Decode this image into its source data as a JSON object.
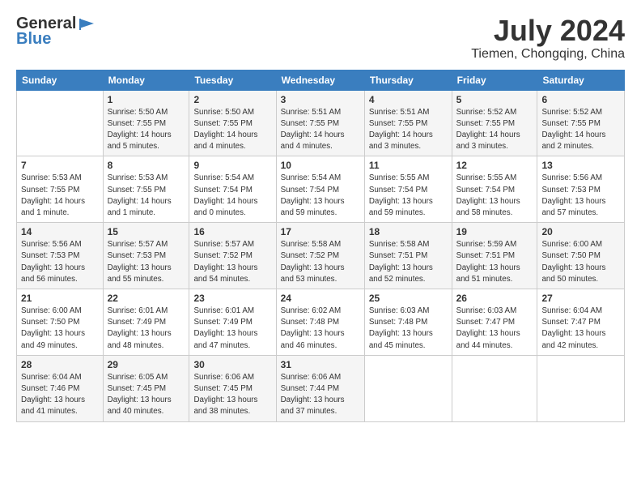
{
  "header": {
    "logo_general": "General",
    "logo_blue": "Blue",
    "month": "July 2024",
    "location": "Tiemen, Chongqing, China"
  },
  "weekdays": [
    "Sunday",
    "Monday",
    "Tuesday",
    "Wednesday",
    "Thursday",
    "Friday",
    "Saturday"
  ],
  "weeks": [
    [
      {
        "day": "",
        "info": ""
      },
      {
        "day": "1",
        "info": "Sunrise: 5:50 AM\nSunset: 7:55 PM\nDaylight: 14 hours\nand 5 minutes."
      },
      {
        "day": "2",
        "info": "Sunrise: 5:50 AM\nSunset: 7:55 PM\nDaylight: 14 hours\nand 4 minutes."
      },
      {
        "day": "3",
        "info": "Sunrise: 5:51 AM\nSunset: 7:55 PM\nDaylight: 14 hours\nand 4 minutes."
      },
      {
        "day": "4",
        "info": "Sunrise: 5:51 AM\nSunset: 7:55 PM\nDaylight: 14 hours\nand 3 minutes."
      },
      {
        "day": "5",
        "info": "Sunrise: 5:52 AM\nSunset: 7:55 PM\nDaylight: 14 hours\nand 3 minutes."
      },
      {
        "day": "6",
        "info": "Sunrise: 5:52 AM\nSunset: 7:55 PM\nDaylight: 14 hours\nand 2 minutes."
      }
    ],
    [
      {
        "day": "7",
        "info": "Sunrise: 5:53 AM\nSunset: 7:55 PM\nDaylight: 14 hours\nand 1 minute."
      },
      {
        "day": "8",
        "info": "Sunrise: 5:53 AM\nSunset: 7:55 PM\nDaylight: 14 hours\nand 1 minute."
      },
      {
        "day": "9",
        "info": "Sunrise: 5:54 AM\nSunset: 7:54 PM\nDaylight: 14 hours\nand 0 minutes."
      },
      {
        "day": "10",
        "info": "Sunrise: 5:54 AM\nSunset: 7:54 PM\nDaylight: 13 hours\nand 59 minutes."
      },
      {
        "day": "11",
        "info": "Sunrise: 5:55 AM\nSunset: 7:54 PM\nDaylight: 13 hours\nand 59 minutes."
      },
      {
        "day": "12",
        "info": "Sunrise: 5:55 AM\nSunset: 7:54 PM\nDaylight: 13 hours\nand 58 minutes."
      },
      {
        "day": "13",
        "info": "Sunrise: 5:56 AM\nSunset: 7:53 PM\nDaylight: 13 hours\nand 57 minutes."
      }
    ],
    [
      {
        "day": "14",
        "info": "Sunrise: 5:56 AM\nSunset: 7:53 PM\nDaylight: 13 hours\nand 56 minutes."
      },
      {
        "day": "15",
        "info": "Sunrise: 5:57 AM\nSunset: 7:53 PM\nDaylight: 13 hours\nand 55 minutes."
      },
      {
        "day": "16",
        "info": "Sunrise: 5:57 AM\nSunset: 7:52 PM\nDaylight: 13 hours\nand 54 minutes."
      },
      {
        "day": "17",
        "info": "Sunrise: 5:58 AM\nSunset: 7:52 PM\nDaylight: 13 hours\nand 53 minutes."
      },
      {
        "day": "18",
        "info": "Sunrise: 5:58 AM\nSunset: 7:51 PM\nDaylight: 13 hours\nand 52 minutes."
      },
      {
        "day": "19",
        "info": "Sunrise: 5:59 AM\nSunset: 7:51 PM\nDaylight: 13 hours\nand 51 minutes."
      },
      {
        "day": "20",
        "info": "Sunrise: 6:00 AM\nSunset: 7:50 PM\nDaylight: 13 hours\nand 50 minutes."
      }
    ],
    [
      {
        "day": "21",
        "info": "Sunrise: 6:00 AM\nSunset: 7:50 PM\nDaylight: 13 hours\nand 49 minutes."
      },
      {
        "day": "22",
        "info": "Sunrise: 6:01 AM\nSunset: 7:49 PM\nDaylight: 13 hours\nand 48 minutes."
      },
      {
        "day": "23",
        "info": "Sunrise: 6:01 AM\nSunset: 7:49 PM\nDaylight: 13 hours\nand 47 minutes."
      },
      {
        "day": "24",
        "info": "Sunrise: 6:02 AM\nSunset: 7:48 PM\nDaylight: 13 hours\nand 46 minutes."
      },
      {
        "day": "25",
        "info": "Sunrise: 6:03 AM\nSunset: 7:48 PM\nDaylight: 13 hours\nand 45 minutes."
      },
      {
        "day": "26",
        "info": "Sunrise: 6:03 AM\nSunset: 7:47 PM\nDaylight: 13 hours\nand 44 minutes."
      },
      {
        "day": "27",
        "info": "Sunrise: 6:04 AM\nSunset: 7:47 PM\nDaylight: 13 hours\nand 42 minutes."
      }
    ],
    [
      {
        "day": "28",
        "info": "Sunrise: 6:04 AM\nSunset: 7:46 PM\nDaylight: 13 hours\nand 41 minutes."
      },
      {
        "day": "29",
        "info": "Sunrise: 6:05 AM\nSunset: 7:45 PM\nDaylight: 13 hours\nand 40 minutes."
      },
      {
        "day": "30",
        "info": "Sunrise: 6:06 AM\nSunset: 7:45 PM\nDaylight: 13 hours\nand 38 minutes."
      },
      {
        "day": "31",
        "info": "Sunrise: 6:06 AM\nSunset: 7:44 PM\nDaylight: 13 hours\nand 37 minutes."
      },
      {
        "day": "",
        "info": ""
      },
      {
        "day": "",
        "info": ""
      },
      {
        "day": "",
        "info": ""
      }
    ]
  ]
}
